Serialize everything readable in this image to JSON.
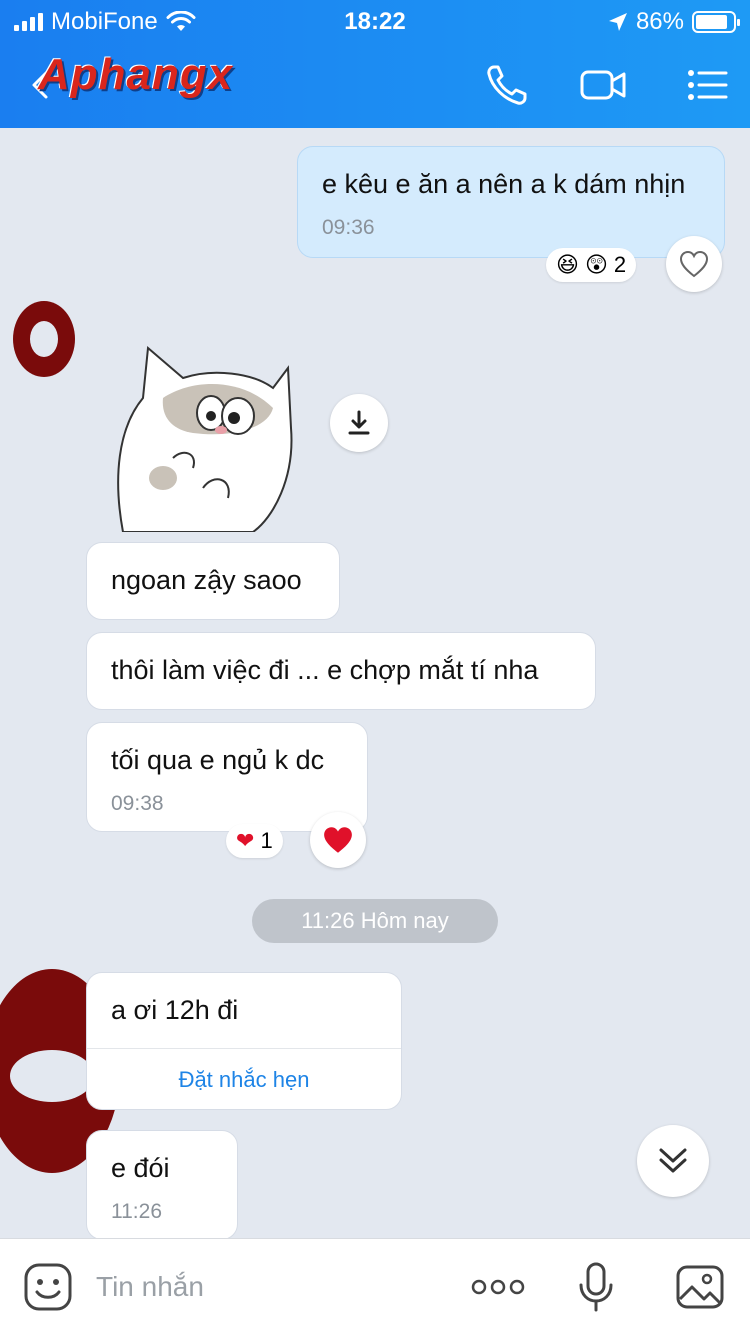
{
  "status_bar": {
    "carrier": "MobiFone",
    "time": "18:22",
    "battery": "86%",
    "battery_level": 0.86
  },
  "header": {
    "logo_text": "Aphangx"
  },
  "messages": [
    {
      "text": "e kêu e ăn a nên a k dám nhịn",
      "time": "09:36",
      "reaction_count": "2"
    },
    {
      "text": "ngoan zậy saoo"
    },
    {
      "text": "thôi làm việc đi ... e chợp mắt tí nha"
    },
    {
      "text": "tối qua e ngủ k dc",
      "time": "09:38",
      "reaction_count": "1"
    },
    {
      "text": "a ơi 12h đi",
      "action": "Đặt nhắc hẹn"
    },
    {
      "text": "e đói",
      "time": "11:26"
    }
  ],
  "date_separator": "11:26 Hôm nay",
  "input": {
    "placeholder": "Tin nhắn"
  },
  "colors": {
    "header_start": "#1a7ef0",
    "header_end": "#1e9af5",
    "chat_bg": "#e3e8f0",
    "my_bubble": "#d4ebfd",
    "link": "#1e84e6",
    "lips": "#7a0b0b"
  }
}
